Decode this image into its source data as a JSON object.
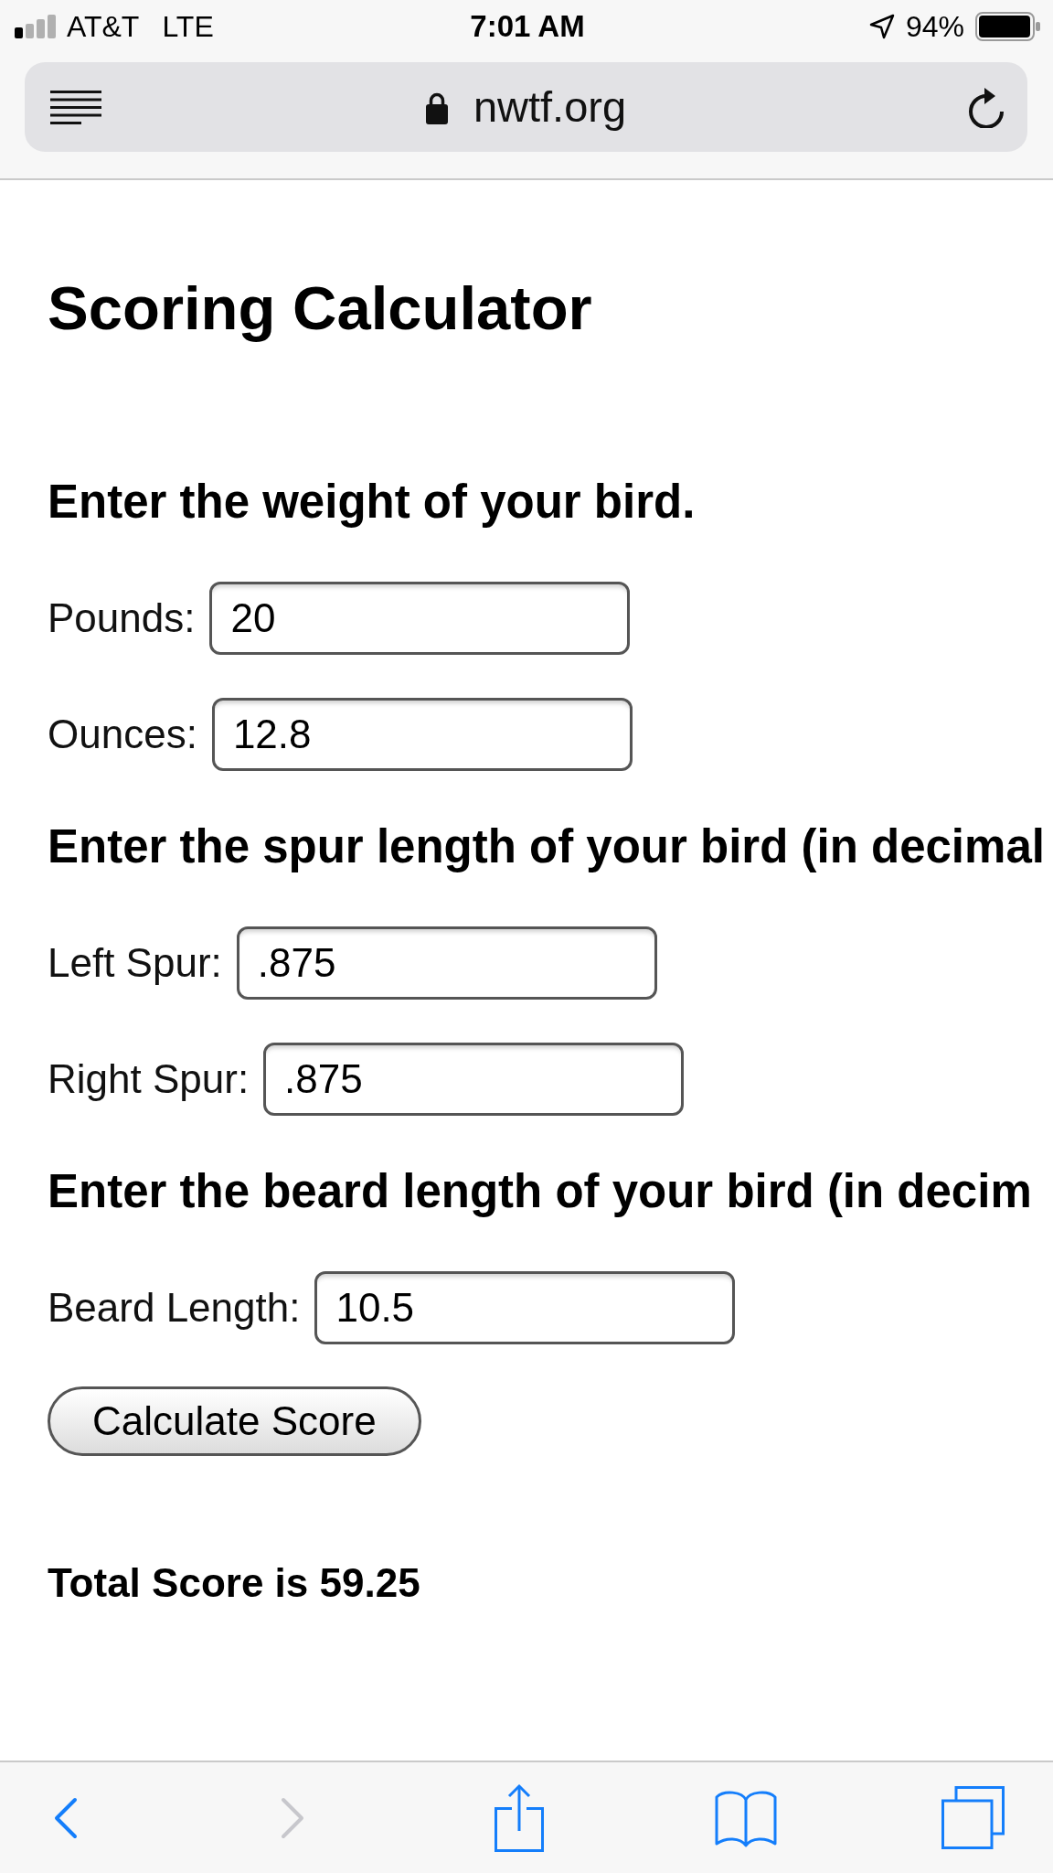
{
  "status_bar": {
    "carrier": "AT&T",
    "network": "LTE",
    "time": "7:01 AM",
    "battery": "94%"
  },
  "address_bar": {
    "url": "nwtf.org"
  },
  "page": {
    "title": "Scoring Calculator",
    "sections": [
      {
        "heading": "Enter the weight of your bird.",
        "fields": [
          {
            "label": "Pounds:",
            "value": "20"
          },
          {
            "label": "Ounces:",
            "value": "12.8"
          }
        ]
      },
      {
        "heading": "Enter the spur length of your bird (in decimal",
        "fields": [
          {
            "label": "Left Spur:",
            "value": ".875"
          },
          {
            "label": "Right Spur:",
            "value": ".875"
          }
        ]
      },
      {
        "heading": "Enter the beard length of your bird (in decim",
        "fields": [
          {
            "label": "Beard Length:",
            "value": "10.5"
          }
        ]
      }
    ],
    "button": "Calculate Score",
    "result": "Total Score is 59.25"
  },
  "toolbar": [
    {
      "kind": "back",
      "disabled": false
    },
    {
      "kind": "forward",
      "disabled": true
    },
    {
      "kind": "share",
      "disabled": false
    },
    {
      "kind": "bookmarks",
      "disabled": false
    },
    {
      "kind": "tabs",
      "disabled": false
    }
  ]
}
